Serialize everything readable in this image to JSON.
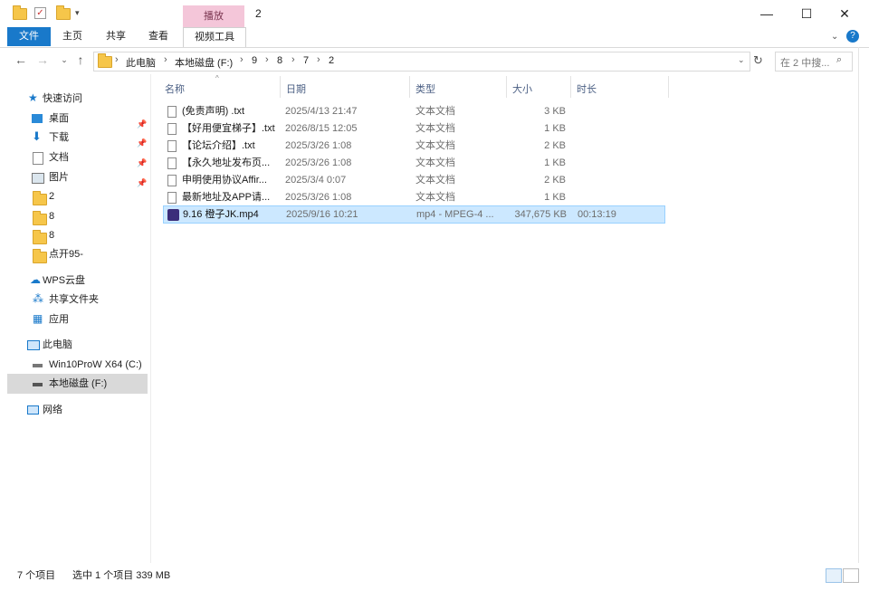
{
  "window": {
    "title": "2",
    "context_tab": "播放",
    "controls": {
      "minimize": "—",
      "maximize": "☐",
      "close": "✕"
    }
  },
  "ribbon": {
    "tabs": [
      {
        "label": "文件"
      },
      {
        "label": "主页"
      },
      {
        "label": "共享"
      },
      {
        "label": "查看"
      },
      {
        "label": "视频工具"
      }
    ]
  },
  "address": {
    "crumbs": [
      "此电脑",
      "本地磁盘 (F:)",
      "9",
      "8",
      "7",
      "2"
    ],
    "search_placeholder": "在 2 中搜..."
  },
  "sidebar": {
    "quick_access": "快速访问",
    "quick_items": [
      "桌面",
      "下载",
      "文档",
      "图片",
      "2",
      "8",
      "8",
      "点开95-"
    ],
    "wps": "WPS云盘",
    "shared": "共享文件夹",
    "apps": "应用",
    "this_pc": "此电脑",
    "drives": [
      "Win10ProW X64 (C:)",
      "本地磁盘 (F:)"
    ],
    "network": "网络"
  },
  "columns": {
    "name": "名称",
    "date": "日期",
    "type": "类型",
    "size": "大小",
    "duration": "时长"
  },
  "files": [
    {
      "name": "(免责声明) .txt",
      "date": "2025/4/13 21:47",
      "type": "文本文档",
      "size": "3 KB",
      "duration": ""
    },
    {
      "name": "【好用便宜梯子】.txt",
      "date": "2026/8/15 12:05",
      "type": "文本文档",
      "size": "1 KB",
      "duration": ""
    },
    {
      "name": "【论坛介绍】.txt",
      "date": "2025/3/26 1:08",
      "type": "文本文档",
      "size": "2 KB",
      "duration": ""
    },
    {
      "name": "【永久地址发布页...",
      "date": "2025/3/26 1:08",
      "type": "文本文档",
      "size": "1 KB",
      "duration": ""
    },
    {
      "name": "申明使用协议Affir...",
      "date": "2025/3/4 0:07",
      "type": "文本文档",
      "size": "2 KB",
      "duration": ""
    },
    {
      "name": "最新地址及APP请...",
      "date": "2025/3/26 1:08",
      "type": "文本文档",
      "size": "1 KB",
      "duration": ""
    },
    {
      "name": "9.16 橙子JK.mp4",
      "date": "2025/9/16 10:21",
      "type": "mp4 - MPEG-4 ...",
      "size": "347,675 KB",
      "duration": "00:13:19"
    }
  ],
  "status": {
    "count": "7 个项目",
    "selected": "选中 1 个项目 339 MB"
  },
  "colors": {
    "accent": "#1979ca",
    "context_tab": "#f4c6d9",
    "selected_row": "#cce8ff",
    "nav_selected": "#d9d9d9"
  }
}
